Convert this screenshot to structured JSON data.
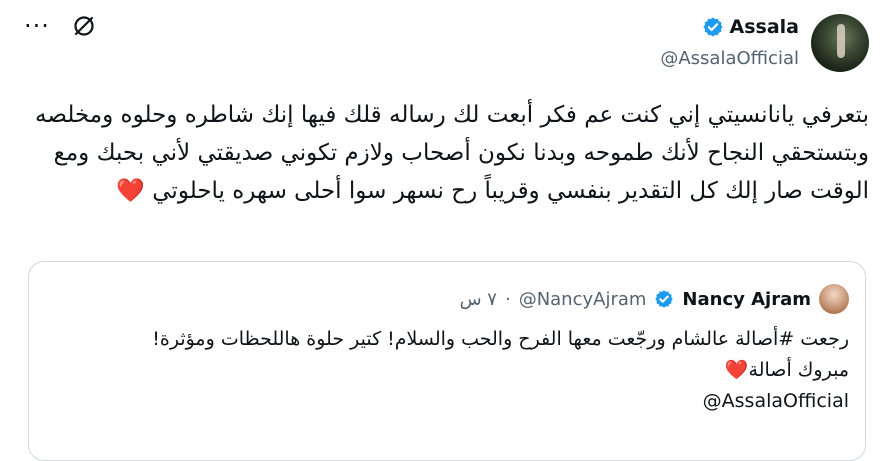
{
  "tweet": {
    "display_name": "Assala",
    "handle": "@AssalaOfficial",
    "text": "بتعرفي يانانسيتي إني كنت عم فكر أبعت لك رساله قلك فيها إنك شاطره وحلوه ومخلصه وبتستحقي النجاح لأنك طموحه وبدنا نكون أصحاب ولازم تكوني صديقتي لأني بحبك ومع الوقت صار إلك كل التقدير بنفسي وقريباً رح نسهر سوا أحلى سهره ياحلوتي",
    "emoji": "❤️"
  },
  "actions": {
    "grok_icon": "grok-icon",
    "more_label": "···"
  },
  "quoted": {
    "display_name": "Nancy Ajram",
    "handle": "@NancyAjram",
    "separator": "·",
    "time": "٧ س",
    "line1": "رجعت #أصالة عالشام ورجّعت معها الفرح والحب والسلام! كتير حلوة هاللحظات ومؤثرة!",
    "line2": "مبروك أصالة",
    "emoji": "❤️",
    "mention": "@AssalaOfficial"
  },
  "colors": {
    "text": "#0f1419",
    "muted": "#536471",
    "verified": "#1d9bf0",
    "border": "#cfd9de",
    "heart": "#e0245e"
  }
}
